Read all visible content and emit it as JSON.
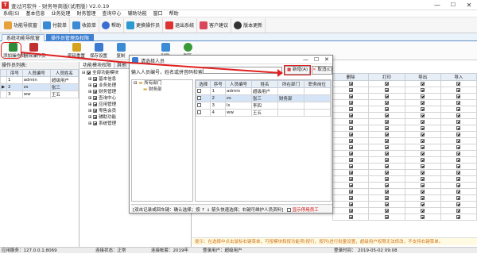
{
  "window": {
    "title": "查过问软件 - 财务导商版(试用版) V2.0.19",
    "min": "—",
    "max": "☐",
    "close": "✕"
  },
  "menu": [
    "系统(S)",
    "基本信息",
    "业务处理",
    "财务管理",
    "查询中心",
    "辅助功能",
    "窗口",
    "帮助"
  ],
  "toolbar": [
    {
      "label": "功能导航窗",
      "color": "#e7a13a"
    },
    {
      "label": "付款单",
      "color": "#3a8ad6"
    },
    {
      "label": "收款单",
      "color": "#3a8ad6"
    },
    {
      "label": "帮助",
      "color": "#3a6fcf"
    },
    {
      "label": "更换操作员",
      "color": "#2a9ad0"
    },
    {
      "label": "退出系统",
      "color": "#d33"
    },
    {
      "label": "客户建议",
      "color": "#d9475a"
    },
    {
      "label": "版本更新",
      "color": "#333"
    }
  ],
  "tabs": [
    "系统功能导航窗",
    "操作员管理及权限"
  ],
  "subtools": [
    {
      "label": "添加操作员",
      "color": "#2e8b3a"
    },
    {
      "label": "删除操作员",
      "color": "#c03030"
    },
    {
      "label": "密码重置",
      "color": "#d6a31e"
    },
    {
      "label": "保存设置",
      "color": "#3a7ad0"
    },
    {
      "label": "复制",
      "color": "#3a8ad6"
    },
    {
      "label": "粘贴",
      "color": "#3a8ad6"
    },
    {
      "label": "刷新",
      "color": "#3a9a3a"
    }
  ],
  "operator_list": {
    "label": "操作员列表:",
    "headers": [
      "序号",
      "人员编号",
      "人员姓名"
    ],
    "rows": [
      [
        "1",
        "admin",
        "超级用户"
      ],
      [
        "2",
        "zs",
        "张三"
      ],
      [
        "3",
        "ww",
        "王五"
      ]
    ]
  },
  "mid_tabs": [
    "功能模块权限",
    "其他"
  ],
  "perm_tree": [
    "全部功能模块",
    "基本信息",
    "业务处理",
    "财务管理",
    "查询中心",
    "应用管理",
    "零售会员",
    "辅助功能",
    "系统管理"
  ],
  "right_headers": [
    "删除",
    "打印",
    "导出",
    "导入"
  ],
  "dialog": {
    "title": "请选择人员",
    "search_label": "输入人员编号，姓名或拼音码检索：",
    "search_value": "",
    "add_button": "新增(A)",
    "cancel_button": "取消(C)",
    "dept_root": "所有部门",
    "dept_child": "财务部",
    "headers": [
      "选择",
      "序号",
      "人员编号",
      "姓名",
      "所在部门",
      "职务岗位"
    ],
    "rows": [
      [
        "1",
        "admin",
        "超级用户",
        ""
      ],
      [
        "2",
        "zs",
        "张三",
        "财务部"
      ],
      [
        "3",
        "ls",
        "李四",
        ""
      ],
      [
        "4",
        "ww",
        "王五",
        ""
      ]
    ],
    "footer": "[双击记录或回车键：确认选择；按 ↑ ↓ 箭头快速选择；右键可维护人员资料]",
    "show_deleted": "显示停用员工"
  },
  "hint": "提示：在选择中点击鼠标右键菜单，可按模块和按功能项(按行，按列)进行批量设置，超级用户权限无法修改，不支持右键菜单。",
  "status": {
    "server": "应用服务：127.0.0.1:8069",
    "connection": "连接状态：正常",
    "account": "连接帐套：2019年",
    "user": "登录用户：超级用户",
    "login_time": "登录时间：",
    "datetime": "2019-05-02 09:08"
  }
}
